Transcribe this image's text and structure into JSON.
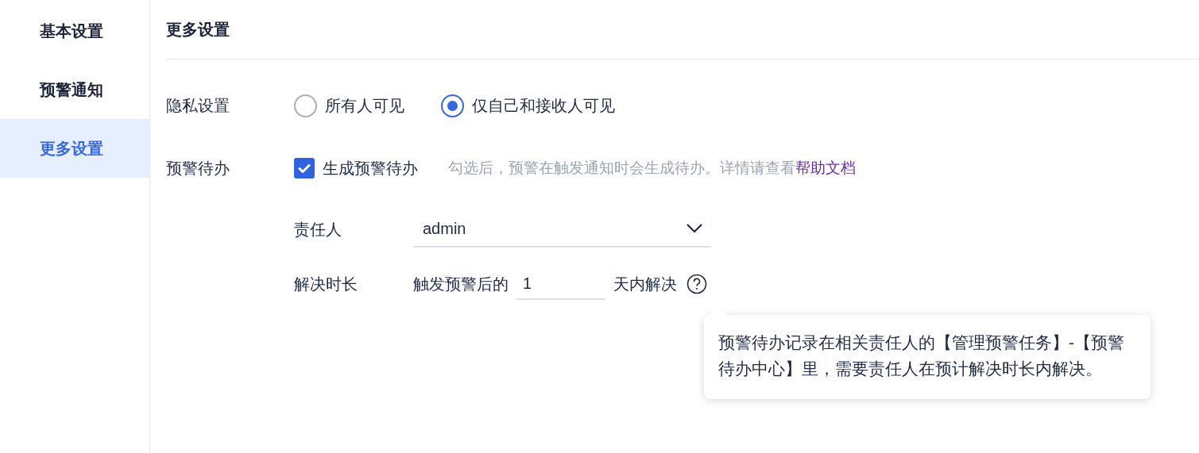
{
  "sidebar": {
    "items": [
      {
        "label": "基本设置",
        "selected": false
      },
      {
        "label": "预警通知",
        "selected": false
      },
      {
        "label": "更多设置",
        "selected": true
      }
    ]
  },
  "title": "更多设置",
  "privacy": {
    "label": "隐私设置",
    "options": [
      {
        "label": "所有人可见",
        "selected": false
      },
      {
        "label": "仅自己和接收人可见",
        "selected": true
      }
    ]
  },
  "todo": {
    "label": "预警待办",
    "checkbox": {
      "label": "生成预警待办",
      "checked": true
    },
    "hint": "勾选后，预警在触发通知时会生成待办。详情请查看",
    "link": "帮助文档"
  },
  "owner": {
    "label": "责任人",
    "value": "admin"
  },
  "duration": {
    "label": "解决时长",
    "prefix": "触发预警后的",
    "value": "1",
    "suffix": "天内解决"
  },
  "tooltip": {
    "text": "预警待办记录在相关责任人的【管理预警任务】-【预警待办中心】里，需要责任人在预计解决时长内解决。"
  }
}
